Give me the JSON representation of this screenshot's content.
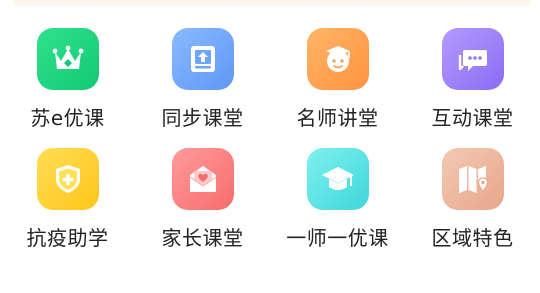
{
  "menu": {
    "items": [
      {
        "label": "苏e优课",
        "icon": "crown-icon",
        "color_from": "#2fe28e",
        "color_to": "#13c873"
      },
      {
        "label": "同步课堂",
        "icon": "upload-tray-icon",
        "color_from": "#8ab9ff",
        "color_to": "#5e98f5"
      },
      {
        "label": "名师讲堂",
        "icon": "teacher-avatar-icon",
        "color_from": "#ffb566",
        "color_to": "#ff9240"
      },
      {
        "label": "互动课堂",
        "icon": "chat-bubbles-icon",
        "color_from": "#b39bff",
        "color_to": "#8a6cf2"
      },
      {
        "label": "抗疫助学",
        "icon": "shield-plus-icon",
        "color_from": "#ffdd55",
        "color_to": "#ffc61a"
      },
      {
        "label": "家长课堂",
        "icon": "heart-envelope-icon",
        "color_from": "#ff9a9a",
        "color_to": "#f76d6d"
      },
      {
        "label": "一师一优课",
        "icon": "graduation-cap-icon",
        "color_from": "#7ff0ee",
        "color_to": "#3fd6db"
      },
      {
        "label": "区域特色",
        "icon": "map-pin-icon",
        "color_from": "#f4c9b3",
        "color_to": "#e8a68b"
      }
    ]
  }
}
